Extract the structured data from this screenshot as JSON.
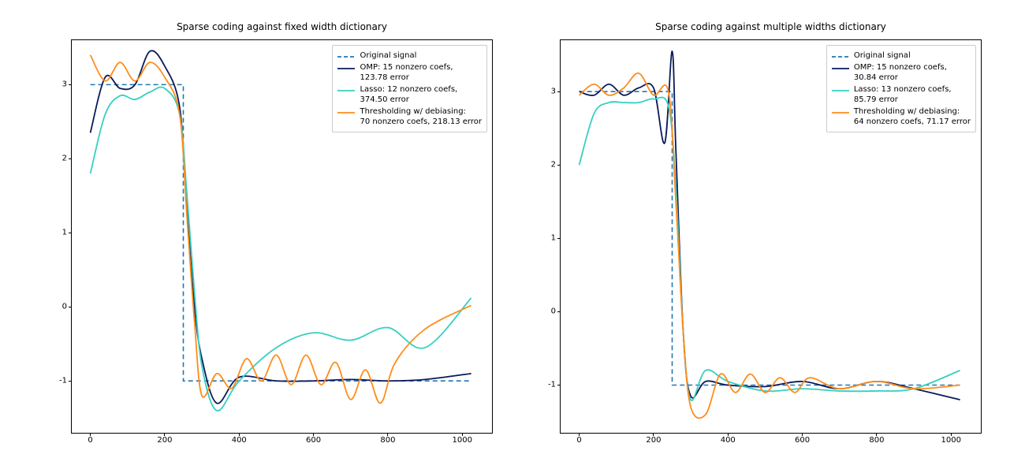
{
  "chart_data": [
    {
      "type": "line",
      "title": "Sparse coding against fixed width dictionary",
      "xlabel": "",
      "ylabel": "",
      "xlim": [
        -50,
        1080
      ],
      "ylim": [
        -1.7,
        3.6
      ],
      "xticks": [
        0,
        200,
        400,
        600,
        800,
        1000
      ],
      "yticks": [
        -1,
        0,
        1,
        2,
        3
      ],
      "legend": [
        "Original signal",
        "OMP: 15 nonzero coefs,\n123.78 error",
        "Lasso: 12 nonzero coefs,\n374.50 error",
        "Thresholding w/ debiasing:\n70 nonzero coefs, 218.13 error"
      ],
      "series": [
        {
          "name": "Original signal",
          "style": "dashed",
          "color": "#1f77b4",
          "x": [
            0,
            250,
            250,
            1024
          ],
          "y": [
            3.0,
            3.0,
            -1.0,
            -1.0
          ]
        },
        {
          "name": "OMP",
          "style": "solid",
          "color": "#0b1a5a",
          "x": [
            0,
            40,
            80,
            120,
            160,
            200,
            240,
            260,
            280,
            300,
            340,
            400,
            500,
            600,
            700,
            800,
            900,
            1024
          ],
          "y": [
            2.35,
            3.1,
            2.95,
            3.0,
            3.45,
            3.25,
            2.7,
            1.3,
            0.0,
            -0.7,
            -1.3,
            -0.95,
            -1.0,
            -1.0,
            -0.98,
            -1.0,
            -0.98,
            -0.9
          ]
        },
        {
          "name": "Lasso",
          "style": "solid",
          "color": "#35d0c0",
          "x": [
            0,
            40,
            80,
            120,
            160,
            200,
            240,
            260,
            280,
            300,
            340,
            400,
            500,
            600,
            700,
            800,
            900,
            1024
          ],
          "y": [
            1.8,
            2.6,
            2.85,
            2.8,
            2.9,
            2.95,
            2.6,
            1.5,
            0.2,
            -0.8,
            -1.4,
            -1.0,
            -0.55,
            -0.35,
            -0.45,
            -0.28,
            -0.55,
            0.12
          ]
        },
        {
          "name": "Thresholding w/ debiasing",
          "style": "solid",
          "color": "#ff8c1a",
          "x": [
            0,
            40,
            80,
            120,
            160,
            200,
            240,
            260,
            280,
            300,
            340,
            380,
            420,
            460,
            500,
            540,
            580,
            620,
            660,
            700,
            740,
            780,
            820,
            900,
            1024
          ],
          "y": [
            3.4,
            3.05,
            3.3,
            3.05,
            3.3,
            3.1,
            2.6,
            1.2,
            -0.2,
            -1.2,
            -0.9,
            -1.1,
            -0.7,
            -1.0,
            -0.65,
            -1.05,
            -0.65,
            -1.05,
            -0.75,
            -1.25,
            -0.85,
            -1.3,
            -0.75,
            -0.3,
            0.02
          ]
        }
      ]
    },
    {
      "type": "line",
      "title": "Sparse coding against multiple widths dictionary",
      "xlabel": "",
      "ylabel": "",
      "xlim": [
        -50,
        1080
      ],
      "ylim": [
        -1.65,
        3.7
      ],
      "xticks": [
        0,
        200,
        400,
        600,
        800,
        1000
      ],
      "yticks": [
        -1,
        0,
        1,
        2,
        3
      ],
      "legend": [
        "Original signal",
        "OMP: 15 nonzero coefs,\n30.84 error",
        "Lasso: 13 nonzero coefs,\n85.79 error",
        "Thresholding w/ debiasing:\n64 nonzero coefs, 71.17 error"
      ],
      "series": [
        {
          "name": "Original signal",
          "style": "dashed",
          "color": "#1f77b4",
          "x": [
            0,
            250,
            250,
            1024
          ],
          "y": [
            3.0,
            3.0,
            -1.0,
            -1.0
          ]
        },
        {
          "name": "OMP",
          "style": "solid",
          "color": "#0b1a5a",
          "x": [
            0,
            40,
            80,
            120,
            160,
            200,
            230,
            250,
            260,
            280,
            300,
            340,
            400,
            500,
            600,
            700,
            800,
            900,
            1024
          ],
          "y": [
            3.0,
            2.95,
            3.1,
            2.95,
            3.05,
            3.05,
            2.3,
            3.55,
            2.2,
            -0.3,
            -1.15,
            -0.95,
            -1.0,
            -1.02,
            -0.95,
            -1.05,
            -0.95,
            -1.05,
            -1.2
          ]
        },
        {
          "name": "Lasso",
          "style": "solid",
          "color": "#35d0c0",
          "x": [
            0,
            40,
            80,
            120,
            160,
            200,
            240,
            260,
            280,
            300,
            340,
            400,
            500,
            600,
            700,
            800,
            900,
            1024
          ],
          "y": [
            2.0,
            2.7,
            2.85,
            2.85,
            2.85,
            2.9,
            2.8,
            1.7,
            -0.3,
            -1.2,
            -0.8,
            -0.95,
            -1.08,
            -1.05,
            -1.08,
            -1.08,
            -1.05,
            -0.8
          ]
        },
        {
          "name": "Thresholding w/ debiasing",
          "style": "solid",
          "color": "#ff8c1a",
          "x": [
            0,
            40,
            80,
            120,
            160,
            200,
            240,
            260,
            280,
            300,
            340,
            380,
            420,
            460,
            500,
            540,
            580,
            620,
            700,
            800,
            900,
            1024
          ],
          "y": [
            2.95,
            3.1,
            2.95,
            3.05,
            3.25,
            2.95,
            3.0,
            1.5,
            -0.3,
            -1.3,
            -1.4,
            -0.85,
            -1.1,
            -0.85,
            -1.1,
            -0.9,
            -1.1,
            -0.9,
            -1.05,
            -0.95,
            -1.05,
            -1.0
          ]
        }
      ]
    }
  ],
  "colors": {
    "original": "#1f77b4",
    "omp": "#0b1a5a",
    "lasso": "#35d0c0",
    "threshold": "#ff8c1a"
  }
}
